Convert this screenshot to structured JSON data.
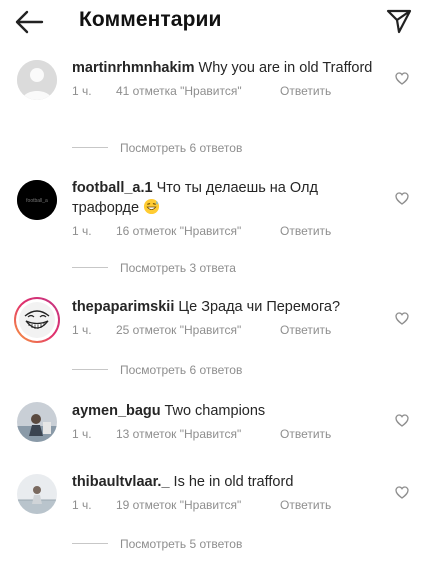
{
  "header": {
    "title": "Комментарии",
    "back_icon": "arrow-left-icon",
    "send_icon": "send-icon"
  },
  "comments": [
    {
      "username": "martinrhmnhakim",
      "text": "Why you are in old Trafford",
      "time": "1 ч.",
      "likes": "41 отметка \"Нравится\"",
      "reply": "Ответить",
      "view_replies": "Посмотреть 6 ответов",
      "avatar": "default-avatar"
    },
    {
      "username": "football_a.1",
      "text": "Что ты делаешь на Олд трафорде",
      "time": "1 ч.",
      "likes": "16 отметок \"Нравится\"",
      "reply": "Ответить",
      "view_replies": "Посмотреть 3 ответа",
      "avatar": "black-logo-avatar",
      "avatar_text": "football_a"
    },
    {
      "username": "thepaparimskii",
      "text": "Це Зрада чи Перемога?",
      "time": "1 ч.",
      "likes": "25 отметок \"Нравится\"",
      "reply": "Ответить",
      "view_replies": "Посмотреть 6 ответов",
      "avatar": "trollface-avatar"
    },
    {
      "username": "aymen_bagu",
      "text": "Two champions",
      "time": "1 ч.",
      "likes": "13 отметок \"Нравится\"",
      "reply": "Ответить",
      "avatar": "photo-avatar"
    },
    {
      "username": "thibaultvlaar._",
      "text": "Is he in old trafford",
      "time": "1 ч.",
      "likes": "19 отметок \"Нравится\"",
      "reply": "Ответить",
      "view_replies": "Посмотреть 5 ответов",
      "avatar": "photo-avatar"
    }
  ],
  "colors": {
    "text": "#262626",
    "secondary": "#8e8e8e",
    "story_ring": "#e1306c"
  }
}
